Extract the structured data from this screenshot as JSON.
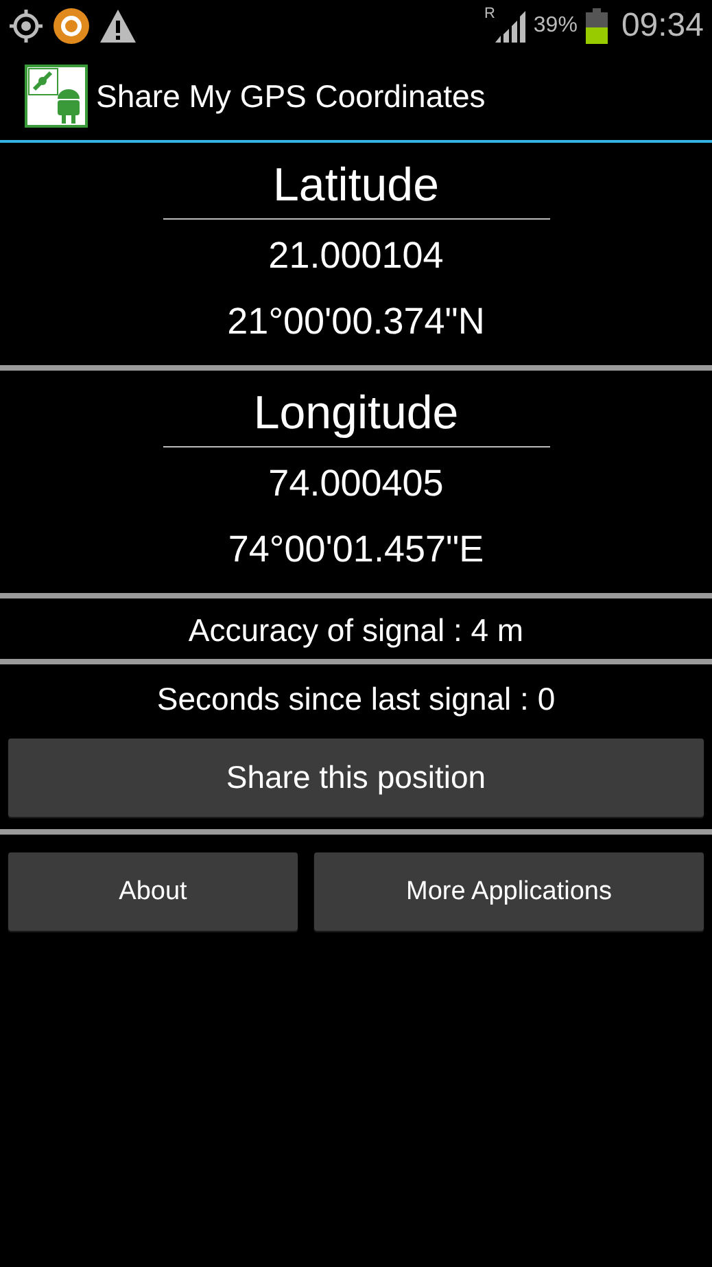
{
  "status_bar": {
    "network_type": "R",
    "battery_percent": "39%",
    "time": "09:34"
  },
  "action_bar": {
    "title": "Share My GPS Coordinates"
  },
  "coordinates": [
    {
      "heading": "Latitude",
      "decimal": "21.000104",
      "dms": "21°00'00.374\"N"
    },
    {
      "heading": "Longitude",
      "decimal": "74.000405",
      "dms": "74°00'01.457\"E"
    }
  ],
  "accuracy": "Accuracy of signal : 4 m",
  "seconds_since": "Seconds since last signal : 0",
  "share_button": "Share this position",
  "bottom_buttons": [
    "About",
    "More Applications"
  ]
}
